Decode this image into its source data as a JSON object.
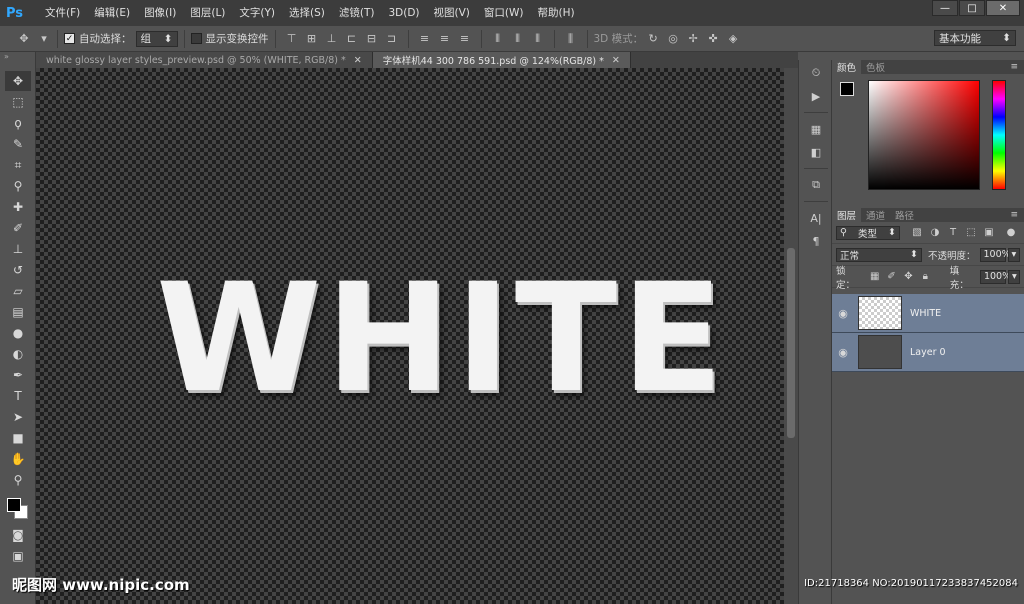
{
  "app": {
    "logo": "Ps"
  },
  "menu": [
    "文件(F)",
    "编辑(E)",
    "图像(I)",
    "图层(L)",
    "文字(Y)",
    "选择(S)",
    "滤镜(T)",
    "3D(D)",
    "视图(V)",
    "窗口(W)",
    "帮助(H)"
  ],
  "window_controls": {
    "minimize": "—",
    "restore": "□",
    "close": "✕"
  },
  "options": {
    "auto_select_label": "自动选择：",
    "auto_select_value": "组",
    "show_transform_label": "显示变换控件",
    "mode_3d_label": "3D 模式：",
    "workspace": "基本功能"
  },
  "doc_tabs": [
    {
      "label": "white glossy layer styles_preview.psd @ 50% (WHITE, RGB/8) *",
      "close": "✕"
    },
    {
      "label": "字体样机44 300 786 591.psd @ 124%(RGB/8) *",
      "close": "✕"
    }
  ],
  "canvas": {
    "text": "WHITE"
  },
  "color_panel": {
    "tabs": [
      "颜色",
      "色板"
    ]
  },
  "layers_panel": {
    "tabs": [
      "图层",
      "通道",
      "路径"
    ],
    "filter_label": "类型",
    "blend_mode": "正常",
    "opacity_label": "不透明度：",
    "opacity_value": "100%",
    "lock_label": "锁定：",
    "fill_label": "填充：",
    "fill_value": "100%",
    "layers": [
      {
        "name": "WHITE"
      },
      {
        "name": "Layer 0"
      }
    ]
  },
  "watermark": {
    "site": "昵图网 www.nipic.com",
    "id": "ID:21718364 NO:20190117233837452084"
  },
  "icons": [
    "move-icon",
    "marquee-icon",
    "lasso-icon",
    "quick-select-icon",
    "crop-icon",
    "eyedropper-icon",
    "healing-icon",
    "brush-icon",
    "stamp-icon",
    "history-brush-icon",
    "eraser-icon",
    "gradient-icon",
    "blur-icon",
    "dodge-icon",
    "pen-icon",
    "type-icon",
    "path-select-icon",
    "rectangle-icon",
    "hand-icon",
    "zoom-icon"
  ]
}
